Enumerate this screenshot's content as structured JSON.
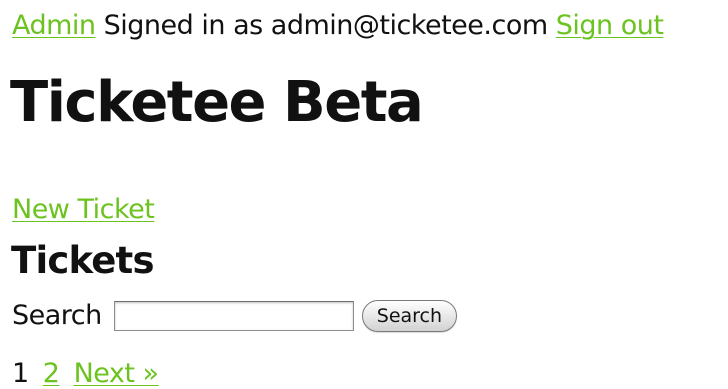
{
  "header": {
    "admin_link": "Admin",
    "signed_in_text": "Signed in as admin@ticketee.com",
    "sign_out_link": "Sign out"
  },
  "site": {
    "title": "Ticketee Beta"
  },
  "main": {
    "new_ticket_link": "New Ticket",
    "section_title": "Tickets",
    "search": {
      "label": "Search",
      "value": "",
      "button_label": "Search"
    },
    "pagination": {
      "current_page": "1",
      "pages": [
        "2"
      ],
      "next_label": "Next »"
    }
  },
  "colors": {
    "link": "#6cc320",
    "text": "#111111",
    "background": "#ffffff"
  }
}
